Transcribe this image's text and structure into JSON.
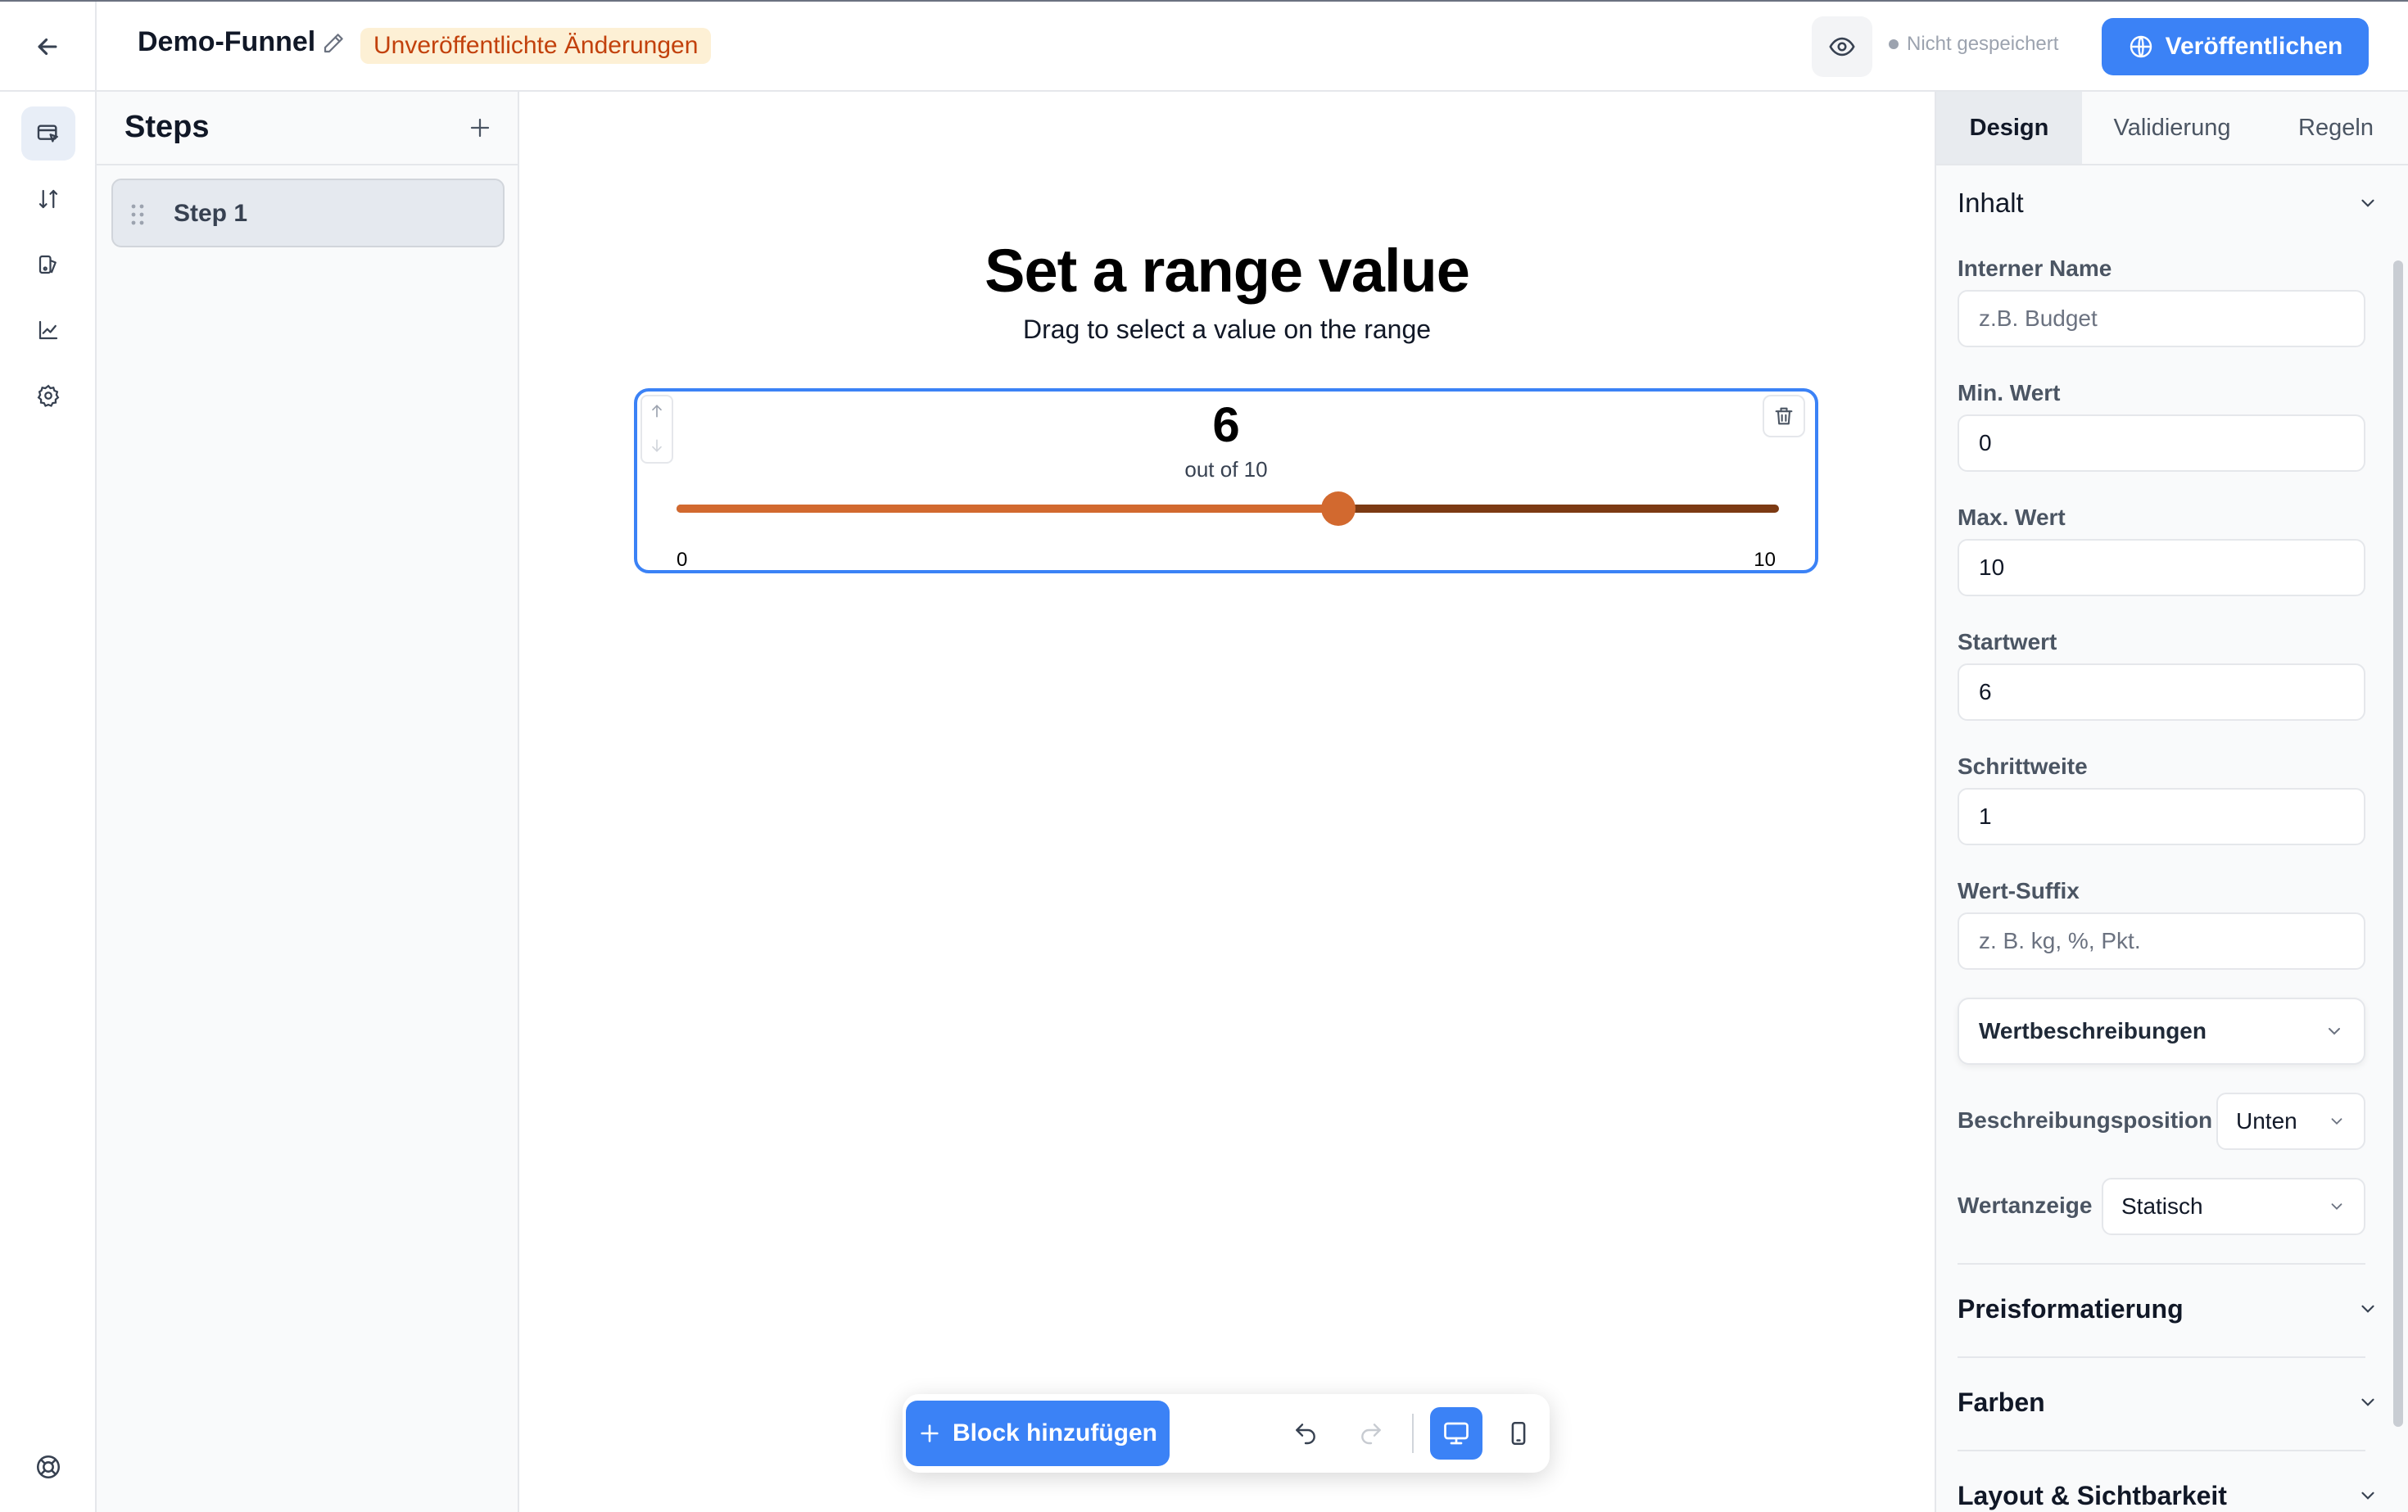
{
  "header": {
    "funnel_title": "Demo-Funnel",
    "unpublished_badge": "Unveröffentlichte Änderungen",
    "save_status": "Nicht gespeichert",
    "publish_label": "Veröffentlichen"
  },
  "rail": {
    "items": [
      "editor-icon",
      "sort-icon",
      "design-icon",
      "analytics-icon",
      "settings-icon"
    ],
    "bottom": "help-icon"
  },
  "steps": {
    "title": "Steps",
    "items": [
      {
        "label": "Step 1"
      }
    ]
  },
  "canvas": {
    "title": "Set a range value",
    "subtitle": "Drag to select a value on the range",
    "range": {
      "value": "6",
      "out_of": "out of 10",
      "min_label": "0",
      "max_label": "10",
      "min": 0,
      "max": 10,
      "current": 6
    }
  },
  "toolbar": {
    "add_block_label": "Block hinzufügen"
  },
  "panel": {
    "tabs": [
      "Design",
      "Validierung",
      "Regeln"
    ],
    "active_tab": "Design",
    "sections": {
      "content": "Inhalt",
      "price_format": "Preisformatierung",
      "colors": "Farben",
      "layout": "Layout & Sichtbarkeit"
    },
    "fields": {
      "internal_name": {
        "label": "Interner Name",
        "value": "",
        "placeholder": "z.B. Budget"
      },
      "min_value": {
        "label": "Min. Wert",
        "value": "0"
      },
      "max_value": {
        "label": "Max. Wert",
        "value": "10"
      },
      "start_value": {
        "label": "Startwert",
        "value": "6"
      },
      "step_size": {
        "label": "Schrittweite",
        "value": "1"
      },
      "value_suffix": {
        "label": "Wert-Suffix",
        "value": "",
        "placeholder": "z. B. kg, %, Pkt."
      }
    },
    "value_descriptions": "Wertbeschreibungen",
    "description_position": {
      "label": "Beschreibungsposition",
      "value": "Unten"
    },
    "value_display": {
      "label": "Wertanzeige",
      "value": "Statisch"
    }
  },
  "colors": {
    "accent": "#3b82f6",
    "slider_fill": "#d2692f",
    "slider_track": "#7c3a13",
    "badge_bg": "#fdf0d5",
    "badge_text": "#c2410c"
  }
}
